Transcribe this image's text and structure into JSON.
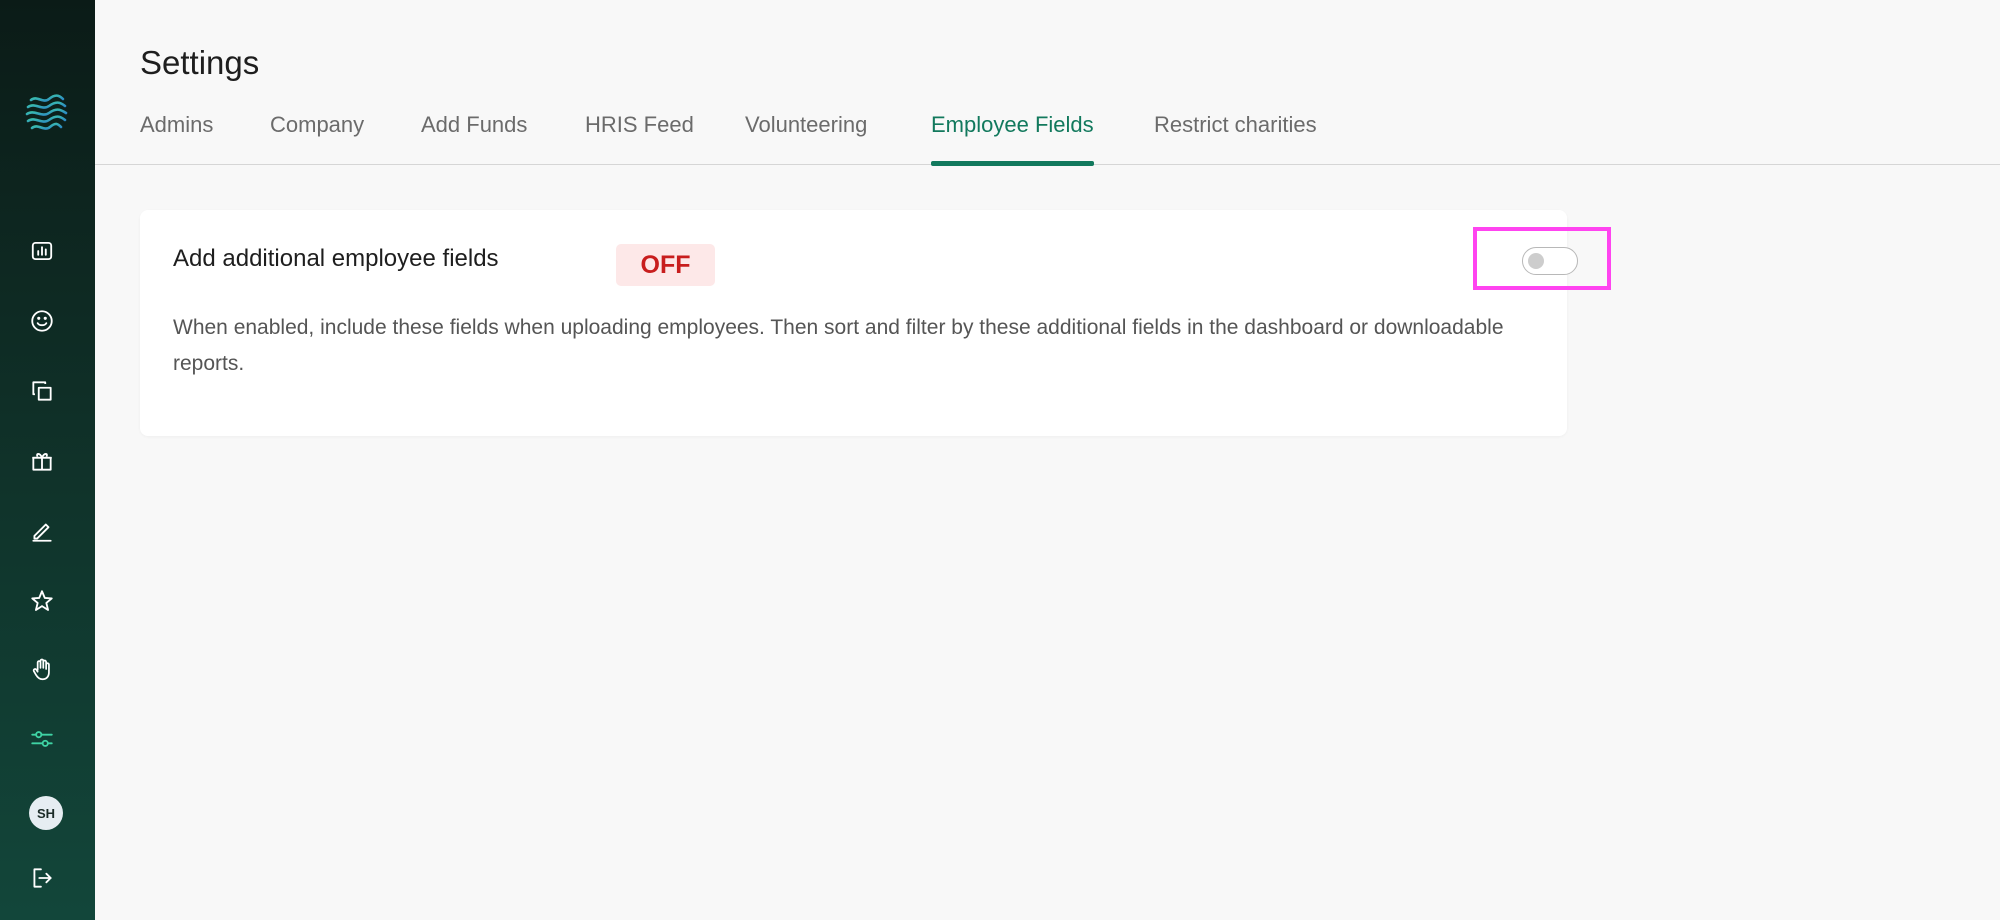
{
  "sidebar": {
    "logo": "wave-logo",
    "items": [
      {
        "icon": "bar-chart-icon",
        "name": "nav-reports"
      },
      {
        "icon": "smiley-icon",
        "name": "nav-employees"
      },
      {
        "icon": "copy-icon",
        "name": "nav-copy"
      },
      {
        "icon": "gift-icon",
        "name": "nav-gifts"
      },
      {
        "icon": "pencil-icon",
        "name": "nav-edit"
      },
      {
        "icon": "star-icon",
        "name": "nav-favorites"
      },
      {
        "icon": "hand-icon",
        "name": "nav-volunteer"
      },
      {
        "icon": "sliders-icon",
        "name": "nav-settings",
        "active": true
      }
    ],
    "avatar_initials": "SH",
    "logout_icon": "logout-icon",
    "active_color": "#3fd3a4"
  },
  "header": {
    "title": "Settings"
  },
  "tabs": [
    {
      "label": "Admins"
    },
    {
      "label": "Company"
    },
    {
      "label": "Add Funds"
    },
    {
      "label": "HRIS Feed"
    },
    {
      "label": "Volunteering"
    },
    {
      "label": "Employee Fields",
      "active": true
    },
    {
      "label": "Restrict charities"
    }
  ],
  "card": {
    "title": "Add additional employee fields",
    "status": "OFF",
    "description": "When enabled, include these fields when uploading employees. Then sort and filter by these additional fields in the dashboard or downloadable reports.",
    "toggle_on": false
  },
  "colors": {
    "accent": "#12795d",
    "status_off_text": "#c81e1e",
    "status_off_bg": "#fde8e8",
    "highlight": "#ff44f0"
  }
}
